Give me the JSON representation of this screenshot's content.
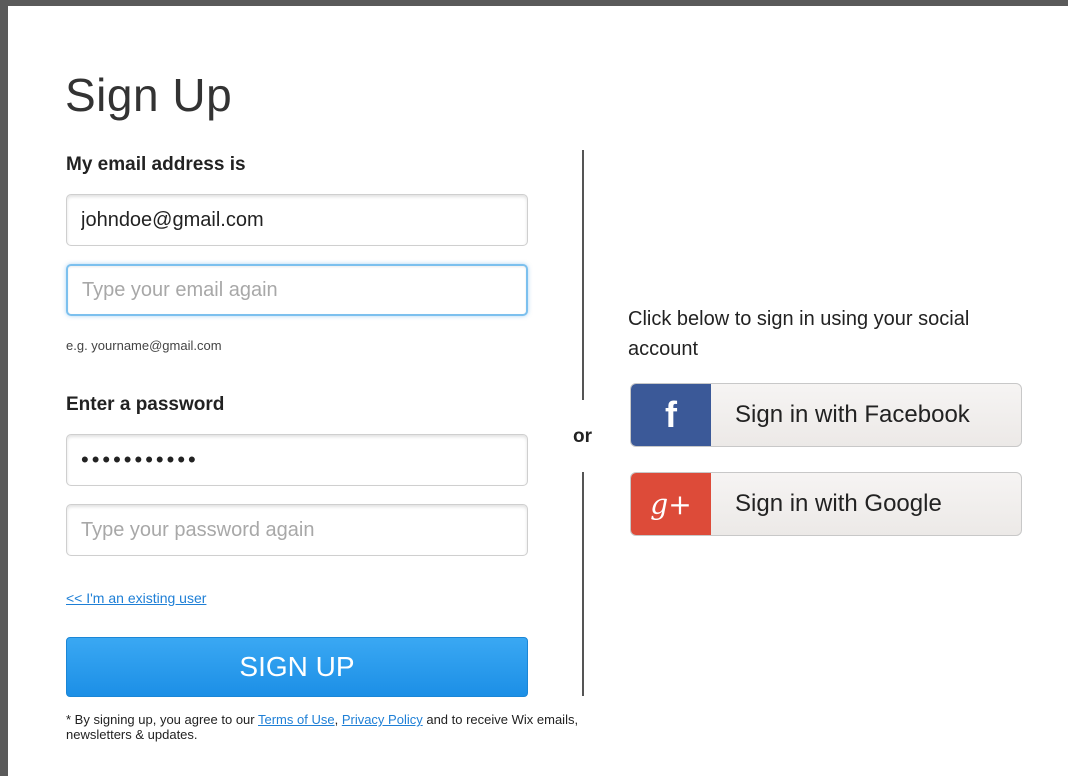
{
  "page": {
    "title": "Sign Up"
  },
  "form": {
    "email_label": "My email address is",
    "email_value": "johndoe@gmail.com",
    "email_confirm_placeholder": "Type your email again",
    "email_hint": "e.g. yourname@gmail.com",
    "password_label": "Enter a password",
    "password_value": "•••••••••••",
    "password_confirm_placeholder": "Type your password again",
    "existing_user_link": "<< I'm an existing user",
    "signup_button": "SIGN UP",
    "terms": {
      "prefix": "* By signing up, you agree to our ",
      "terms_link": "Terms of Use",
      "separator": ", ",
      "privacy_link": "Privacy Policy",
      "suffix": " and to receive Wix emails, newsletters & updates."
    }
  },
  "divider": {
    "or_text": "or"
  },
  "social": {
    "intro_text": "Click below to sign in using your social account",
    "facebook": {
      "label": "Sign in with Facebook",
      "icon": "f",
      "icon_name": "facebook-icon",
      "color": "#3b5998"
    },
    "google": {
      "label": "Sign in with Google",
      "icon": "g+",
      "icon_name": "google-plus-icon",
      "color": "#dd4b39"
    }
  },
  "colors": {
    "primary_button": "#1c8fe6",
    "link": "#1e7fd6",
    "focus_border": "#7cc0ee"
  }
}
